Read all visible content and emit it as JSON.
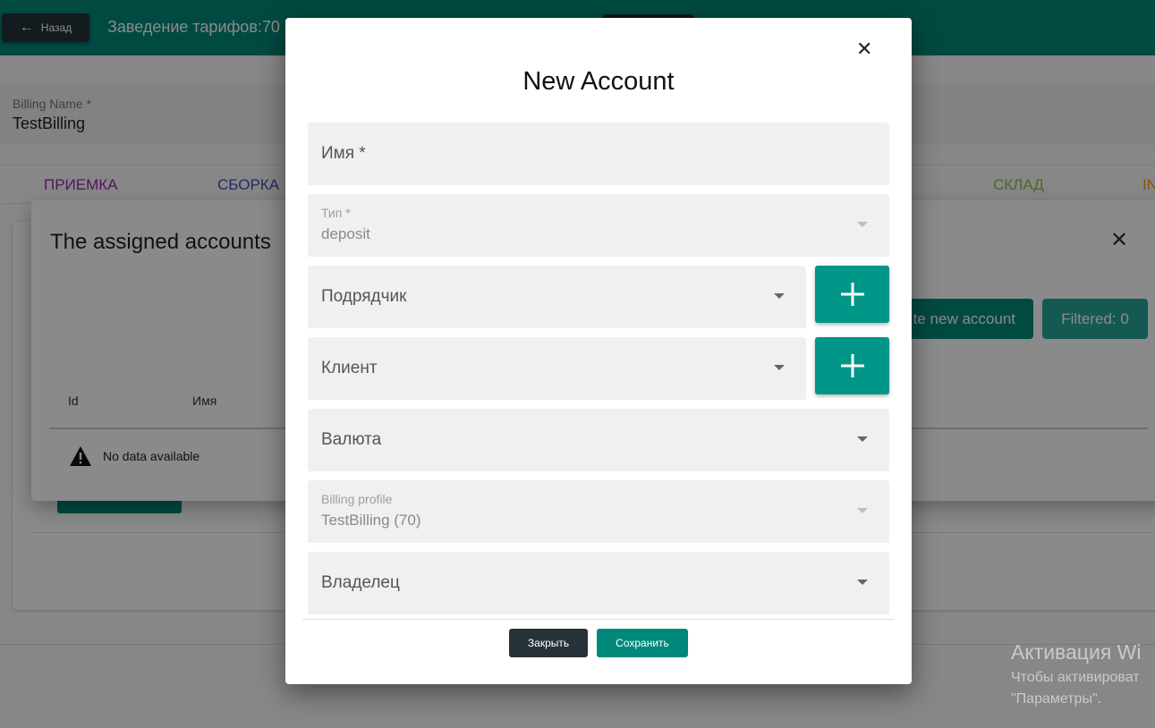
{
  "header": {
    "back_label": "Назад",
    "title": "Заведение тарифов:70"
  },
  "billing": {
    "label": "Billing Name *",
    "value": "TestBilling"
  },
  "tabs": [
    {
      "label": "ПРИЕМКА",
      "color": "#9c27b0"
    },
    {
      "label": "СБОРКА",
      "color": "#3f51b5"
    },
    {
      "label": "СКЛАД",
      "color": "#8bc34a"
    },
    {
      "label": "IN",
      "color": "#ff9800"
    }
  ],
  "assigned_dialog": {
    "title": "The assigned accounts",
    "create_label": "te new account",
    "filtered_label": "Filtered: 0",
    "columns": [
      "Id",
      "Имя"
    ],
    "no_data": "No data available"
  },
  "modal": {
    "title": "New Account",
    "fields": {
      "name": {
        "label": "Имя *"
      },
      "type": {
        "label": "Тип *",
        "value": "deposit"
      },
      "contractor": {
        "label": "Подрядчик"
      },
      "client": {
        "label": "Клиент"
      },
      "currency": {
        "label": "Валюта"
      },
      "billing_profile": {
        "label": "Billing profile",
        "value": "TestBilling (70)"
      },
      "owner": {
        "label": "Владелец"
      }
    },
    "close_label": "Закрыть",
    "save_label": "Сохранить"
  },
  "watermark": {
    "title": "Активация Wi",
    "line1": "Чтобы активироват",
    "line2": "\"Параметры\"."
  },
  "colors": {
    "primary": "#00897b",
    "dark": "#263238",
    "overlay": "rgba(0,0,0,0.46)"
  }
}
